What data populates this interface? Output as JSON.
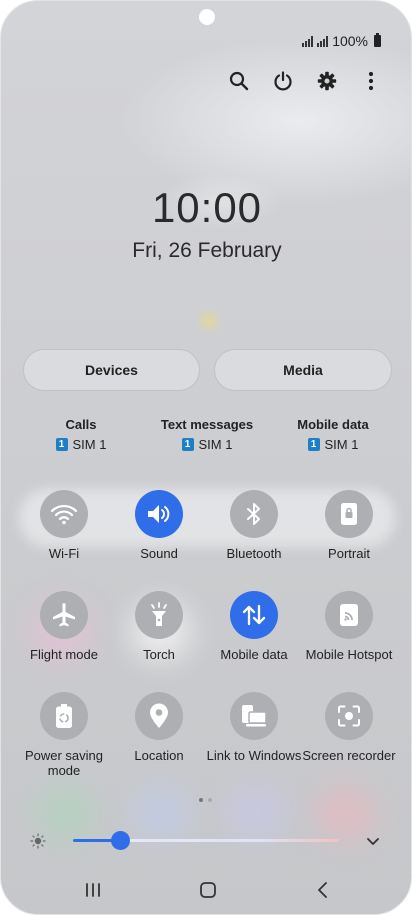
{
  "status_bar": {
    "battery_text": "100%"
  },
  "top_actions": [
    "search-icon",
    "power-icon",
    "gear-icon",
    "more-vert-icon"
  ],
  "clock": {
    "time": "10:00",
    "date": "Fri, 26 February"
  },
  "buttons": {
    "devices": "Devices",
    "media": "Media"
  },
  "sim_settings": [
    {
      "title": "Calls",
      "sim_badge": "1",
      "sim": "SIM 1"
    },
    {
      "title": "Text messages",
      "sim_badge": "1",
      "sim": "SIM 1"
    },
    {
      "title": "Mobile data",
      "sim_badge": "1",
      "sim": "SIM 1"
    }
  ],
  "tiles": [
    {
      "label": "Wi-Fi",
      "icon": "wifi-icon",
      "on": false
    },
    {
      "label": "Sound",
      "icon": "sound-icon",
      "on": true
    },
    {
      "label": "Bluetooth",
      "icon": "bluetooth-icon",
      "on": false
    },
    {
      "label": "Portrait",
      "icon": "portrait-lock-icon",
      "on": false
    },
    {
      "label": "Flight mode",
      "icon": "airplane-icon",
      "on": false
    },
    {
      "label": "Torch",
      "icon": "torch-icon",
      "on": false
    },
    {
      "label": "Mobile data",
      "icon": "mobile-data-icon",
      "on": true
    },
    {
      "label": "Mobile Hotspot",
      "icon": "hotspot-icon",
      "on": false
    },
    {
      "label": "Power saving mode",
      "icon": "battery-saver-icon",
      "on": false
    },
    {
      "label": "Location",
      "icon": "location-icon",
      "on": false
    },
    {
      "label": "Link to Windows",
      "icon": "link-windows-icon",
      "on": false
    },
    {
      "label": "Screen recorder",
      "icon": "screen-recorder-icon",
      "on": false
    }
  ],
  "page_indicator": {
    "current": 1,
    "total": 2
  },
  "brightness": {
    "level": 0.18
  },
  "colors": {
    "accent": "#2f6ee8",
    "tile_off": "#aeafb3",
    "sim_badge": "#1f7fc4"
  }
}
